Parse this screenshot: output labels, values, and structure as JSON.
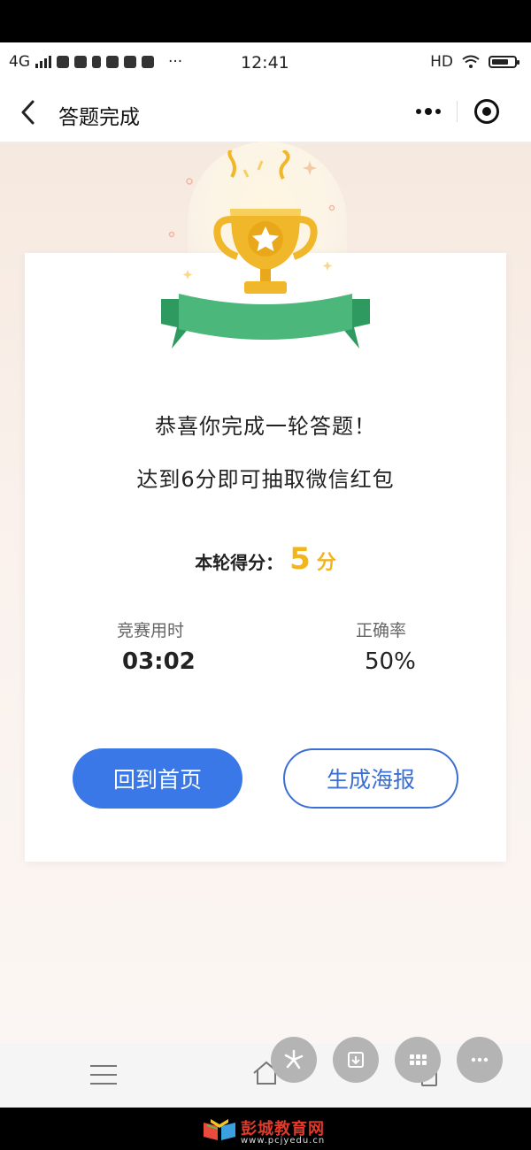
{
  "status_bar": {
    "network": "4G",
    "dots": "···",
    "time": "12:41",
    "hd": "HD"
  },
  "nav": {
    "title": "答题完成"
  },
  "result": {
    "congrats": "恭喜你完成一轮答题！",
    "hint": "达到6分即可抽取微信红包",
    "score_label": "本轮得分：",
    "score_value": "5",
    "score_unit": "分",
    "time_label": "竞赛用时",
    "time_value": "03:02",
    "accuracy_label": "正确率",
    "accuracy_value": "50%"
  },
  "buttons": {
    "home": "回到首页",
    "poster": "生成海报"
  },
  "floating_actions": [
    "pinwheel-icon",
    "download-icon",
    "grid-icon",
    "more-icon"
  ],
  "watermark": {
    "title": "彭城教育网",
    "url": "www.pcjyedu.cn"
  },
  "colors": {
    "primary_button": "#3b78e7",
    "score_accent": "#f2b51c",
    "ribbon": "#4bb77a",
    "trophy": "#f1b72a"
  }
}
